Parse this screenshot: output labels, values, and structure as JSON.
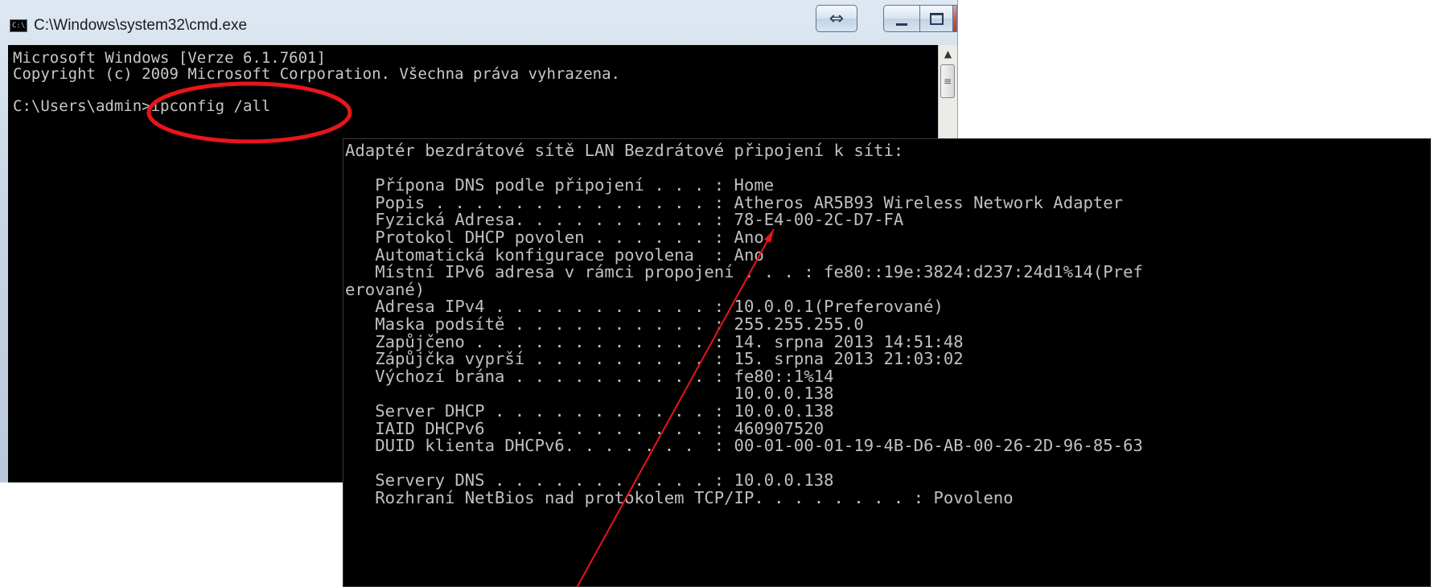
{
  "window": {
    "title": "C:\\Windows\\system32\\cmd.exe",
    "icon": "cmd-icon",
    "icon_text": "C:\\",
    "snap_glyph": "⇔"
  },
  "scrollbar": {
    "up_arrow": "▲",
    "thumb_grip": "≡"
  },
  "console": {
    "lines": [
      "Microsoft Windows [Verze 6.1.7601]",
      "Copyright (c) 2009 Microsoft Corporation. Všechna práva vyhrazena.",
      "",
      "C:\\Users\\admin>ipconfig /all"
    ]
  },
  "output": {
    "lines": [
      "Adaptér bezdrátové sítě LAN Bezdrátové připojení k síti:",
      "",
      "   Přípona DNS podle připojení . . . : Home",
      "   Popis . . . . . . . . . . . . . . : Atheros AR5B93 Wireless Network Adapter",
      "   Fyzická Adresa. . . . . . . . . . : 78-E4-00-2C-D7-FA",
      "   Protokol DHCP povolen . . . . . . : Ano",
      "   Automatická konfigurace povolena  : Ano",
      "   Místní IPv6 adresa v rámci propojení . . . : fe80::19e:3824:d237:24d1%14(Pref",
      "erované)",
      "   Adresa IPv4 . . . . . . . . . . . : 10.0.0.1(Preferované)",
      "   Maska podsítě . . . . . . . . . . : 255.255.255.0",
      "   Zapůjčeno . . . . . . . . . . . . : 14. srpna 2013 14:51:48",
      "   Zápůjčka vyprší . . . . . . . . . : 15. srpna 2013 21:03:02",
      "   Výchozí brána . . . . . . . . . . : fe80::1%14",
      "                                       10.0.0.138",
      "   Server DHCP . . . . . . . . . . . : 10.0.0.138",
      "   IAID DHCPv6   . . . . . . . . . . : 460907520",
      "   DUID klienta DHCPv6. . . . . . .  : 00-01-00-01-19-4B-D6-AB-00-26-2D-96-85-63",
      "",
      "   Servery DNS . . . . . . . . . . . : 10.0.0.138",
      "   Rozhraní NetBios nad protokolem TCP/IP. . . . . . . . : Povoleno"
    ]
  },
  "annotation_colors": {
    "circle": "#e8151b",
    "arrow": "#e8151b"
  }
}
